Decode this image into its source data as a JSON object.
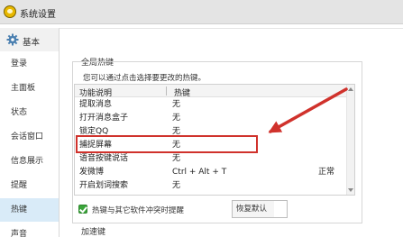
{
  "window": {
    "title": "系统设置"
  },
  "sidebar": {
    "section_label": "基本",
    "items": [
      {
        "label": "登录",
        "active": false
      },
      {
        "label": "主面板",
        "active": false
      },
      {
        "label": "状态",
        "active": false
      },
      {
        "label": "会话窗口",
        "active": false
      },
      {
        "label": "信息展示",
        "active": false
      },
      {
        "label": "提醒",
        "active": false
      },
      {
        "label": "热键",
        "active": true
      },
      {
        "label": "声音",
        "active": false
      }
    ]
  },
  "panel": {
    "section_title": "全局热键",
    "description": "您可以通过点击选择要更改的热键。",
    "table": {
      "columns": [
        "功能说明",
        "热键"
      ],
      "rows": [
        {
          "name": "提取消息",
          "hotkey": "无",
          "status": ""
        },
        {
          "name": "打开消息盒子",
          "hotkey": "无",
          "status": ""
        },
        {
          "name": "锁定QQ",
          "hotkey": "无",
          "status": ""
        },
        {
          "name": "捕捉屏幕",
          "hotkey": "无",
          "status": ""
        },
        {
          "name": "语音按键说话",
          "hotkey": "无",
          "status": ""
        },
        {
          "name": "发微博",
          "hotkey": "Ctrl + Alt + T",
          "status": "正常"
        },
        {
          "name": "开启划词搜索",
          "hotkey": "无",
          "status": ""
        }
      ]
    },
    "conflict_checkbox": {
      "label": "热键与其它软件冲突时提醒",
      "checked": true
    },
    "restore_button": "恢复默认",
    "next_section_title": "加速键"
  },
  "colors": {
    "accent_red": "#d0322c",
    "selected_nav_bg": "#d9ebf8",
    "checkbox_green": "#3aa53a"
  }
}
